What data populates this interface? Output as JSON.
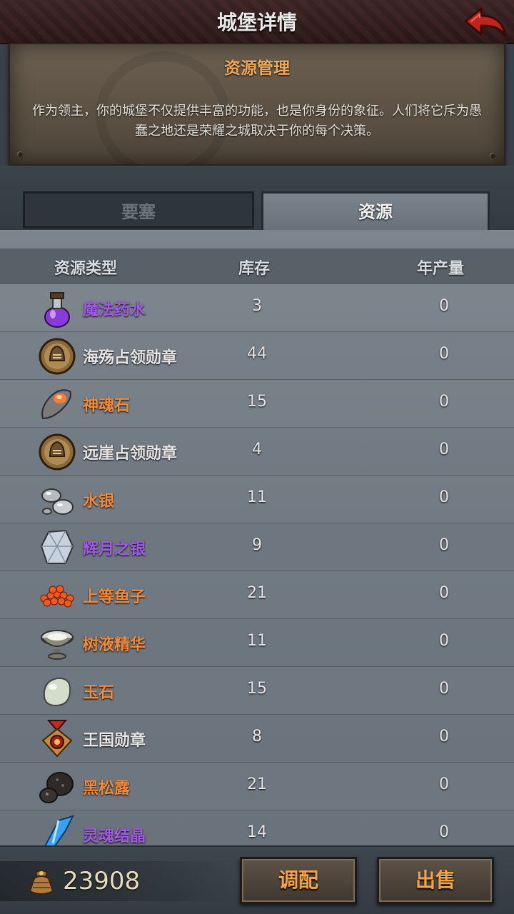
{
  "header": {
    "title": "城堡详情"
  },
  "info": {
    "heading": "资源管理",
    "body": "作为领主，你的城堡不仅提供丰富的功能，也是你身份的象征。人们将它斥为愚蠢之地还是荣耀之城取决于你的每个决策。"
  },
  "tabs": [
    {
      "label": "要塞",
      "active": false
    },
    {
      "label": "资源",
      "active": true
    }
  ],
  "table": {
    "columns": {
      "type": "资源类型",
      "stock": "库存",
      "yearly": "年产量"
    },
    "rows": [
      {
        "name": "魔法药水",
        "stock": "3",
        "yearly": "0",
        "color": "#a05ae6",
        "icon": "potion-icon"
      },
      {
        "name": "海殇占领勋章",
        "stock": "44",
        "yearly": "0",
        "color": "#e6e6e6",
        "icon": "helmet-medal-icon"
      },
      {
        "name": "神魂石",
        "stock": "15",
        "yearly": "0",
        "color": "#f08a3c",
        "icon": "soul-stone-icon"
      },
      {
        "name": "远崖占领勋章",
        "stock": "4",
        "yearly": "0",
        "color": "#e6e6e6",
        "icon": "helmet-medal-icon"
      },
      {
        "name": "水银",
        "stock": "11",
        "yearly": "0",
        "color": "#f08a3c",
        "icon": "mercury-icon"
      },
      {
        "name": "辉月之银",
        "stock": "9",
        "yearly": "0",
        "color": "#a05ae6",
        "icon": "silver-crystal-icon"
      },
      {
        "name": "上等鱼子",
        "stock": "21",
        "yearly": "0",
        "color": "#f08a3c",
        "icon": "caviar-icon"
      },
      {
        "name": "树液精华",
        "stock": "11",
        "yearly": "0",
        "color": "#f08a3c",
        "icon": "sap-bowl-icon"
      },
      {
        "name": "玉石",
        "stock": "15",
        "yearly": "0",
        "color": "#f08a3c",
        "icon": "jade-icon"
      },
      {
        "name": "王国勋章",
        "stock": "8",
        "yearly": "0",
        "color": "#e6e6e6",
        "icon": "kingdom-medal-icon"
      },
      {
        "name": "黑松露",
        "stock": "21",
        "yearly": "0",
        "color": "#f08a3c",
        "icon": "truffle-icon"
      },
      {
        "name": "灵魂结晶",
        "stock": "14",
        "yearly": "0",
        "color": "#a05ae6",
        "icon": "soul-crystal-icon"
      }
    ]
  },
  "footer": {
    "gold": "23908",
    "allocate_label": "调配",
    "sell_label": "出售"
  }
}
